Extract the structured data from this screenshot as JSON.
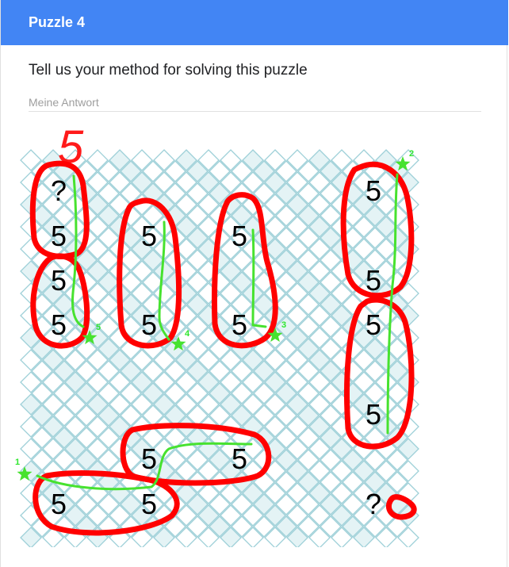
{
  "header": {
    "title": "Puzzle 4"
  },
  "question": {
    "text": "Tell us your method for solving this puzzle"
  },
  "answer": {
    "placeholder": "Meine Antwort",
    "value": ""
  },
  "annotation": {
    "big_label": "5"
  },
  "cells": [
    {
      "text": "?"
    },
    {
      "text": "5"
    },
    {
      "text": "5"
    },
    {
      "text": "5"
    },
    {
      "text": "5"
    },
    {
      "text": "5"
    },
    {
      "text": "5"
    },
    {
      "text": "5"
    },
    {
      "text": "5"
    },
    {
      "text": "5"
    },
    {
      "text": "5"
    },
    {
      "text": "5"
    },
    {
      "text": "5"
    },
    {
      "text": "5"
    },
    {
      "text": "5"
    },
    {
      "text": "5"
    },
    {
      "text": "?"
    }
  ],
  "stars": [
    {
      "label": "1"
    },
    {
      "label": "2"
    },
    {
      "label": "3"
    },
    {
      "label": "4"
    },
    {
      "label": "5"
    }
  ],
  "colors": {
    "header": "#4285f4",
    "grid_stroke": "#9ed0d8",
    "grid_fill": "#e4f3f5",
    "circle_stroke": "#ff0000",
    "path_stroke": "#47e22f",
    "star_fill": "#47e22f"
  }
}
